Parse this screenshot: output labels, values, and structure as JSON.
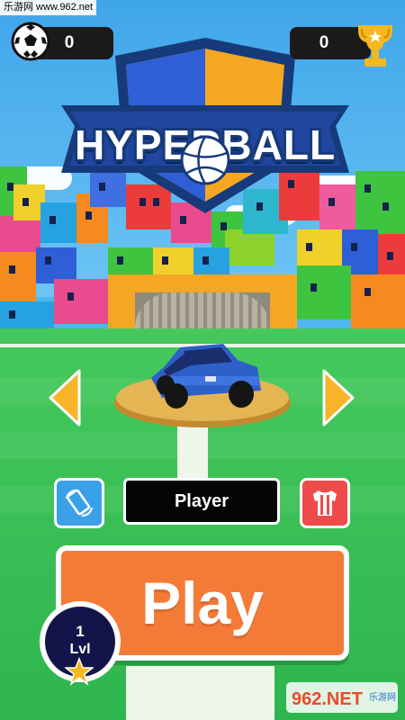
{
  "watermark_top": "乐游网 www.962.net",
  "watermark_bottom": {
    "brand": "962.NET",
    "sub": "乐游网"
  },
  "hud": {
    "coins": {
      "icon": "soccer-ball-icon",
      "value": "0"
    },
    "trophies": {
      "icon": "trophy-icon",
      "value": "0"
    }
  },
  "logo": {
    "title": "HYPERBALL",
    "icon": "volleyball-icon"
  },
  "car_selector": {
    "prev_icon": "arrow-left-icon",
    "next_icon": "arrow-right-icon",
    "car_color": "#2f5fc8"
  },
  "controls": {
    "rotate_icon": "rotate-phone-icon",
    "player_name": "Player",
    "jersey_icon": "jersey-icon"
  },
  "play_button": {
    "label": "Play"
  },
  "level": {
    "number": "1",
    "label": "Lvl",
    "icon": "star-icon"
  },
  "colors": {
    "play": "#f47a38",
    "rotate": "#3aa0e8",
    "jersey": "#ef4b4b",
    "arrow": "#f7b52a",
    "level_badge": "#13154a",
    "field": "#3cc057"
  }
}
